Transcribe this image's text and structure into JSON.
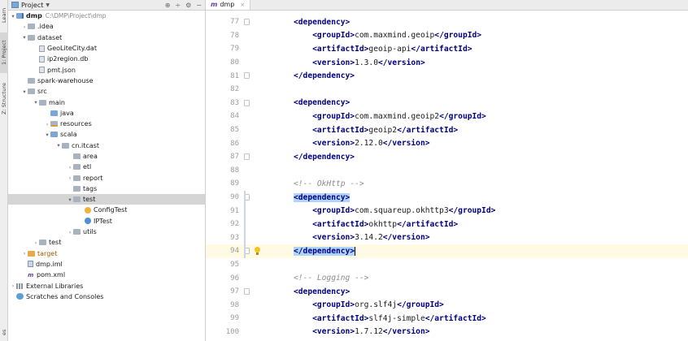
{
  "toolstrip": {
    "tabs": [
      {
        "label": "Learn",
        "icon": "learn-icon"
      },
      {
        "label": "1: Project",
        "icon": "project-icon"
      },
      {
        "label": "Z: Structure",
        "icon": "structure-icon"
      },
      {
        "label": "es",
        "icon": ""
      }
    ]
  },
  "project_panel": {
    "title": "Project",
    "tools": [
      "gear-target-icon",
      "collapse-icon",
      "settings-icon",
      "minimize-icon"
    ],
    "tree": [
      {
        "indent": 0,
        "arrow": "down",
        "icon": "module",
        "label": "dmp",
        "bold": true,
        "path": "C:\\DMP\\Project\\dmp"
      },
      {
        "indent": 1,
        "arrow": "right",
        "icon": "folder",
        "label": ".idea"
      },
      {
        "indent": 1,
        "arrow": "down",
        "icon": "folder",
        "label": "dataset"
      },
      {
        "indent": 2,
        "arrow": "",
        "icon": "file",
        "label": "GeoLiteCity.dat"
      },
      {
        "indent": 2,
        "arrow": "",
        "icon": "file",
        "label": "ip2region.db"
      },
      {
        "indent": 2,
        "arrow": "",
        "icon": "file",
        "label": "pmt.json"
      },
      {
        "indent": 1,
        "arrow": "",
        "icon": "folder",
        "label": "spark-warehouse"
      },
      {
        "indent": 1,
        "arrow": "down",
        "icon": "folder",
        "label": "src"
      },
      {
        "indent": 2,
        "arrow": "down",
        "icon": "folder",
        "label": "main"
      },
      {
        "indent": 3,
        "arrow": "",
        "icon": "folder-blue",
        "label": "java"
      },
      {
        "indent": 3,
        "arrow": "right",
        "icon": "folder-res",
        "label": "resources"
      },
      {
        "indent": 3,
        "arrow": "down",
        "icon": "folder-blue",
        "label": "scala"
      },
      {
        "indent": 4,
        "arrow": "down",
        "icon": "folder",
        "label": "cn.itcast"
      },
      {
        "indent": 5,
        "arrow": "",
        "icon": "folder",
        "label": "area"
      },
      {
        "indent": 5,
        "arrow": "right",
        "icon": "folder",
        "label": "etl"
      },
      {
        "indent": 5,
        "arrow": "right",
        "icon": "folder",
        "label": "report"
      },
      {
        "indent": 5,
        "arrow": "",
        "icon": "folder",
        "label": "tags"
      },
      {
        "indent": 5,
        "arrow": "down",
        "icon": "folder",
        "label": "test",
        "selected": true
      },
      {
        "indent": 6,
        "arrow": "",
        "icon": "class-o",
        "label": "ConfigTest"
      },
      {
        "indent": 6,
        "arrow": "",
        "icon": "class-b",
        "label": "IPTest"
      },
      {
        "indent": 5,
        "arrow": "right",
        "icon": "folder",
        "label": "utils"
      },
      {
        "indent": 2,
        "arrow": "right",
        "icon": "folder",
        "label": "test"
      },
      {
        "indent": 1,
        "arrow": "right",
        "icon": "folder-orange",
        "label": "target",
        "orange": true
      },
      {
        "indent": 1,
        "arrow": "",
        "icon": "iml",
        "label": "dmp.iml"
      },
      {
        "indent": 1,
        "arrow": "",
        "icon": "maven",
        "label": "pom.xml"
      },
      {
        "indent": 0,
        "arrow": "right",
        "icon": "libs",
        "label": "External Libraries"
      },
      {
        "indent": 0,
        "arrow": "",
        "icon": "scratch",
        "label": "Scratches and Consoles"
      }
    ]
  },
  "editor": {
    "tab": {
      "icon": "m",
      "label": "dmp",
      "close": "×"
    },
    "lines": [
      {
        "num": "77",
        "indent": 0,
        "kind": "open",
        "text": "dependency",
        "fold": true
      },
      {
        "num": "78",
        "indent": 1,
        "kind": "elem",
        "tag": "groupId",
        "value": "com.maxmind.geoip"
      },
      {
        "num": "79",
        "indent": 1,
        "kind": "elem",
        "tag": "artifactId",
        "value": "geoip-api"
      },
      {
        "num": "80",
        "indent": 1,
        "kind": "elem",
        "tag": "version",
        "value": "1.3.0"
      },
      {
        "num": "81",
        "indent": 0,
        "kind": "close",
        "text": "dependency",
        "fold": true
      },
      {
        "num": "82",
        "indent": 0,
        "kind": "blank"
      },
      {
        "num": "83",
        "indent": 0,
        "kind": "open",
        "text": "dependency",
        "fold": true
      },
      {
        "num": "84",
        "indent": 1,
        "kind": "elem",
        "tag": "groupId",
        "value": "com.maxmind.geoip2"
      },
      {
        "num": "85",
        "indent": 1,
        "kind": "elem",
        "tag": "artifactId",
        "value": "geoip2"
      },
      {
        "num": "86",
        "indent": 1,
        "kind": "elem",
        "tag": "version",
        "value": "2.12.0"
      },
      {
        "num": "87",
        "indent": 0,
        "kind": "close",
        "text": "dependency",
        "fold": true
      },
      {
        "num": "88",
        "indent": 0,
        "kind": "blank"
      },
      {
        "num": "89",
        "indent": 0,
        "kind": "comment",
        "text": "<!-- OkHttp -->"
      },
      {
        "num": "90",
        "indent": 0,
        "kind": "open",
        "text": "dependency",
        "fold": true,
        "highlight": true
      },
      {
        "num": "91",
        "indent": 1,
        "kind": "elem",
        "tag": "groupId",
        "value": "com.squareup.okhttp3"
      },
      {
        "num": "92",
        "indent": 1,
        "kind": "elem",
        "tag": "artifactId",
        "value": "okhttp"
      },
      {
        "num": "93",
        "indent": 1,
        "kind": "elem",
        "tag": "version",
        "value": "3.14.2"
      },
      {
        "num": "94",
        "indent": 0,
        "kind": "close",
        "text": "dependency",
        "fold": true,
        "highlight": true,
        "current": true,
        "bulb": true
      },
      {
        "num": "95",
        "indent": 0,
        "kind": "blank"
      },
      {
        "num": "96",
        "indent": 0,
        "kind": "comment",
        "text": "<!-- Logging -->"
      },
      {
        "num": "97",
        "indent": 0,
        "kind": "open",
        "text": "dependency",
        "fold": true
      },
      {
        "num": "98",
        "indent": 1,
        "kind": "elem",
        "tag": "groupId",
        "value": "org.slf4j"
      },
      {
        "num": "99",
        "indent": 1,
        "kind": "elem",
        "tag": "artifactId",
        "value": "slf4j-simple"
      },
      {
        "num": "100",
        "indent": 1,
        "kind": "elem",
        "tag": "version",
        "value": "1.7.12"
      }
    ]
  }
}
